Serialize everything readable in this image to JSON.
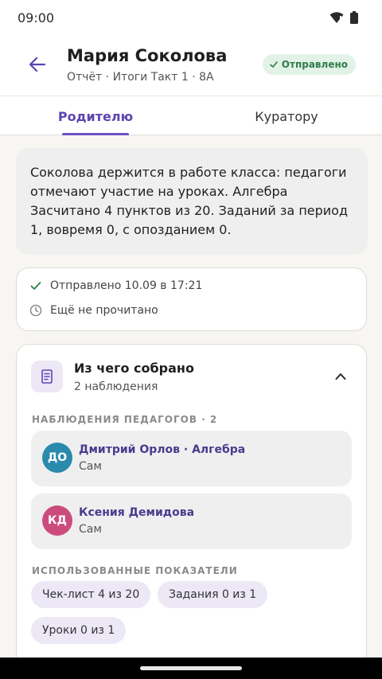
{
  "status_bar": {
    "time": "09:00"
  },
  "header": {
    "name": "Мария Соколова",
    "subtitle": "Отчёт · Итоги Такт 1 · 8А",
    "badge": "Отправлено"
  },
  "tabs": [
    {
      "label": "Родителю",
      "active": true
    },
    {
      "label": "Куратору",
      "active": false
    }
  ],
  "summary_text": "Соколова держится в работе класса: педагоги отмечают участие на уроках. Алгебра Засчитано 4 пунктов из 20. Заданий за период 1, вовремя 0, с опозданием 0.",
  "delivery": {
    "sent": "Отправлено 10.09 в 17:21",
    "read": "Ещё не прочитано"
  },
  "sources": {
    "title": "Из чего собрано",
    "count_text": "2 наблюдения",
    "observations_label": "НАБЛЮДЕНИЯ ПЕДАГОГОВ · 2",
    "observations": [
      {
        "initials": "ДО",
        "name": "Дмитрий Орлов · Алгебра",
        "role": "Сам",
        "color": "#2a8aab"
      },
      {
        "initials": "КД",
        "name": "Ксения Демидова",
        "role": "Сам",
        "color": "#cc4b7d"
      }
    ],
    "indicators_label": "ИСПОЛЬЗОВАННЫЕ ПОКАЗАТЕЛИ",
    "indicators": [
      "Чек-лист 4 из 20",
      "Задания 0 из 1",
      "Уроки 0 из 1"
    ]
  },
  "colors": {
    "accent": "#5b45b0",
    "success": "#2e7d4a",
    "surface": "#f7f6f2"
  }
}
